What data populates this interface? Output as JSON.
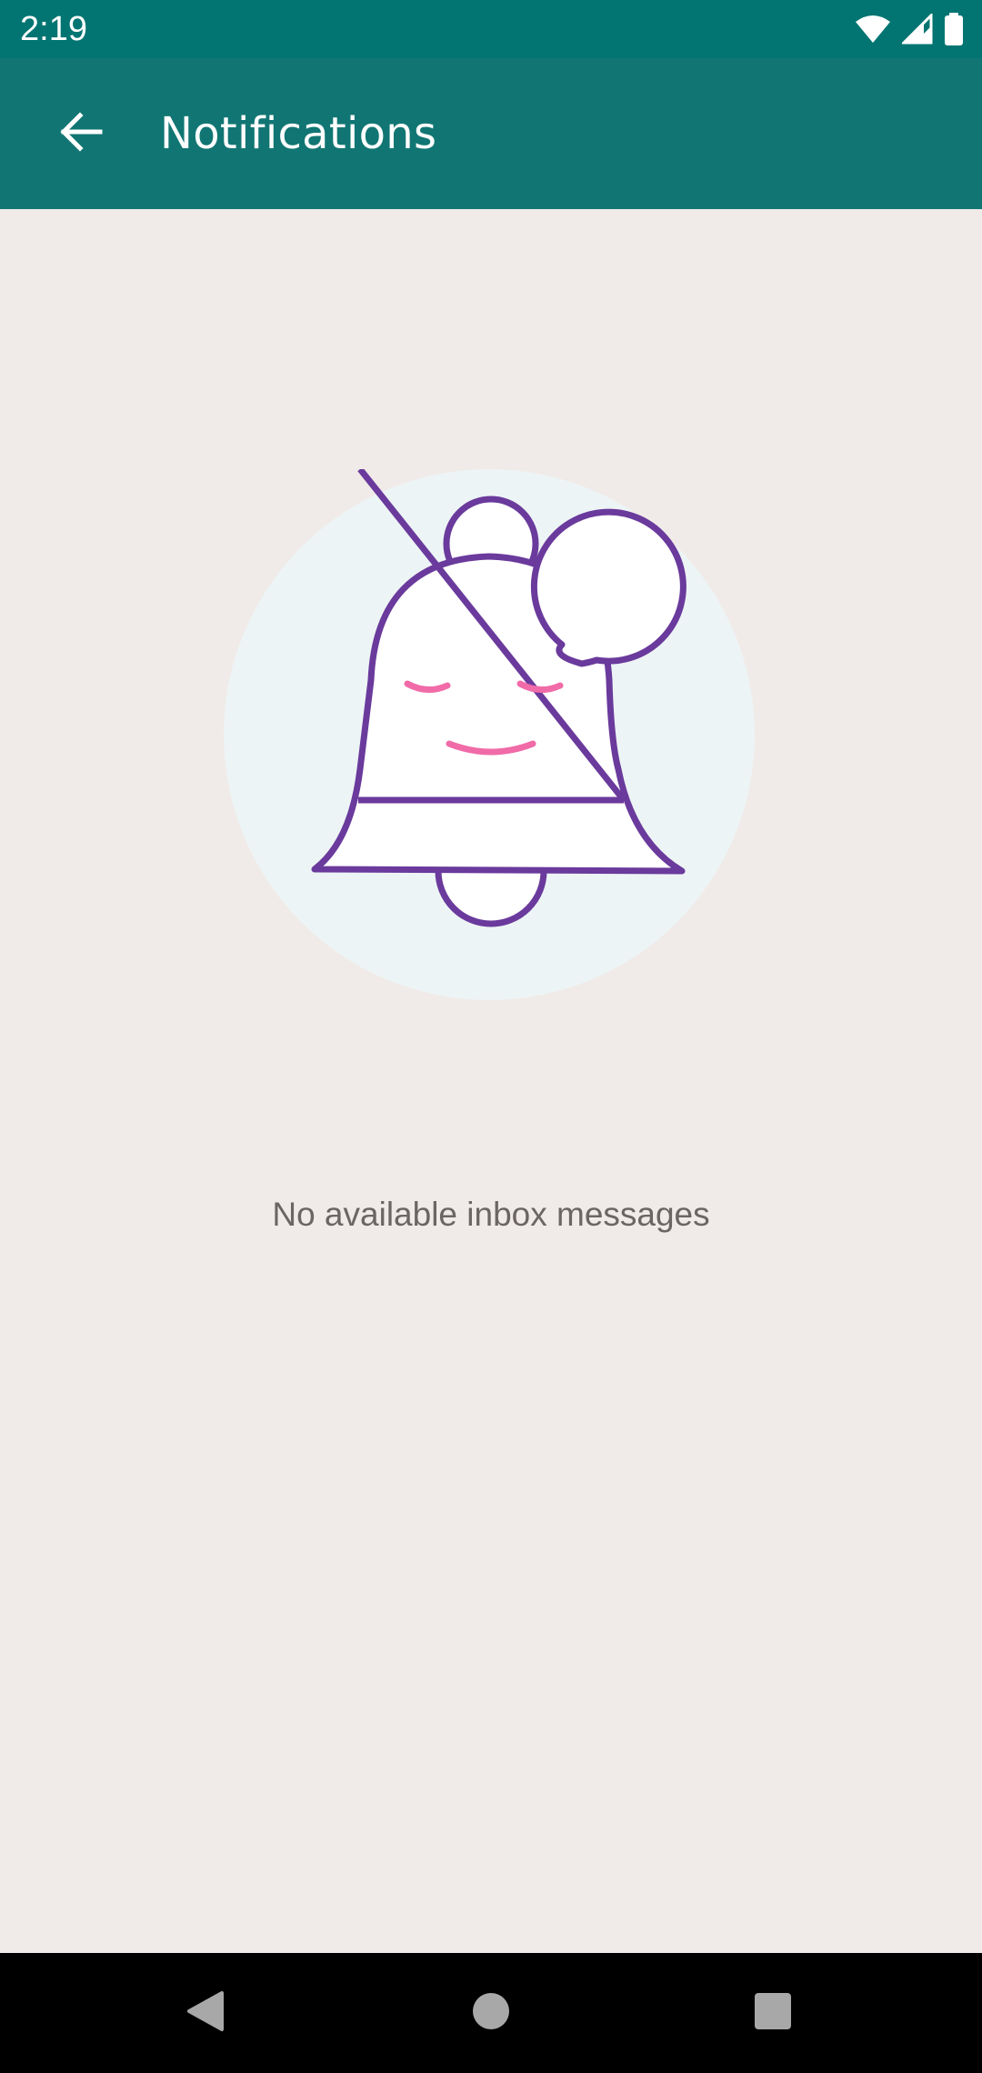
{
  "status_bar": {
    "time": "2:19",
    "icons": [
      "wifi-icon",
      "signal-icon",
      "battery-icon"
    ]
  },
  "app_bar": {
    "title": "Notifications",
    "back_icon": "arrow-left-icon",
    "background_color": "#117673"
  },
  "empty_state": {
    "illustration": "bell-with-speech-bubble-illustration",
    "message": "No available inbox messages"
  },
  "nav_bar": {
    "buttons": [
      "back-triangle-icon",
      "home-circle-icon",
      "recents-square-icon"
    ]
  },
  "colors": {
    "status_bar": "#027572",
    "app_bar": "#117673",
    "background": "#f0ebe8",
    "illustration_stroke": "#6a3a9c",
    "illustration_accent": "#f06ba8",
    "illustration_circle": "#edf4f5"
  }
}
